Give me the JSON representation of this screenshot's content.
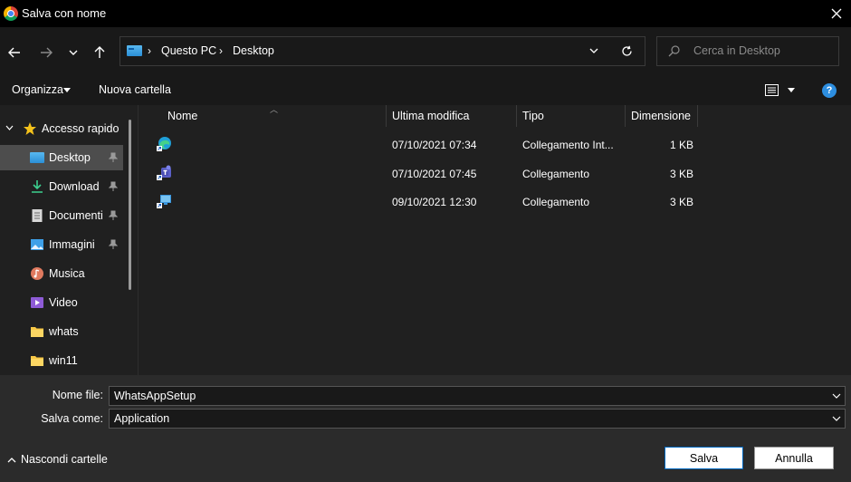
{
  "window": {
    "title": "Salva con nome"
  },
  "address": {
    "breadcrumbs": [
      "Questo PC",
      "Desktop"
    ],
    "search_placeholder": "Cerca in Desktop"
  },
  "toolbar": {
    "organize": "Organizza",
    "new_folder": "Nuova cartella"
  },
  "sidebar": {
    "items": [
      {
        "label": "Accesso rapido",
        "icon": "star-icon"
      },
      {
        "label": "Desktop",
        "icon": "desktop-icon",
        "pinned": true,
        "selected": true
      },
      {
        "label": "Download",
        "icon": "download-icon",
        "pinned": true
      },
      {
        "label": "Documenti",
        "icon": "document-icon",
        "pinned": true
      },
      {
        "label": "Immagini",
        "icon": "pictures-icon",
        "pinned": true
      },
      {
        "label": "Musica",
        "icon": "music-icon"
      },
      {
        "label": "Video",
        "icon": "video-icon"
      },
      {
        "label": "whats",
        "icon": "folder-icon"
      },
      {
        "label": "win11",
        "icon": "folder-icon"
      }
    ]
  },
  "columns": {
    "name": "Nome",
    "modified": "Ultima modifica",
    "type": "Tipo",
    "size": "Dimensione"
  },
  "files": [
    {
      "name": "",
      "modified": "07/10/2021 07:34",
      "type": "Collegamento Int...",
      "size": "1 KB",
      "icon": "edge-shortcut-icon"
    },
    {
      "name": "",
      "modified": "07/10/2021 07:45",
      "type": "Collegamento",
      "size": "3 KB",
      "icon": "teams-shortcut-icon"
    },
    {
      "name": "",
      "modified": "09/10/2021 12:30",
      "type": "Collegamento",
      "size": "3 KB",
      "icon": "remote-desktop-shortcut-icon"
    }
  ],
  "form": {
    "filename_label": "Nome file:",
    "filename_value": "WhatsAppSetup",
    "savetype_label": "Salva come:",
    "savetype_value": "Application"
  },
  "footer": {
    "hide_folders": "Nascondi cartelle",
    "save": "Salva",
    "cancel": "Annulla"
  },
  "colors": {
    "accent": "#0067c0",
    "selected_bg": "#4d4d4d",
    "help": "#2d8ee0"
  }
}
